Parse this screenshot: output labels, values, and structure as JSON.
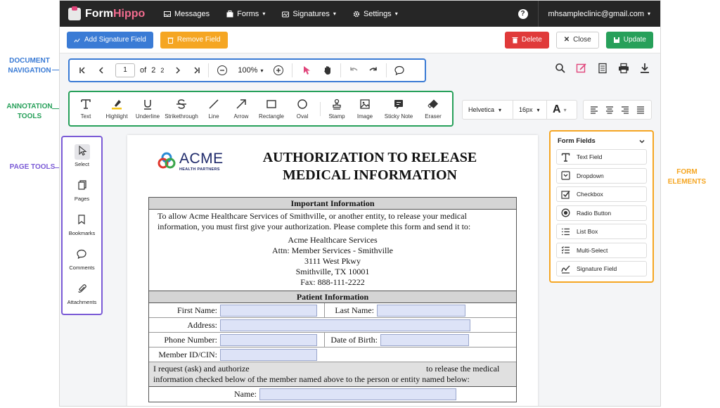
{
  "callouts": {
    "doc_nav": "DOCUMENT\nNAVIGATION",
    "annotation": "ANNOTATION\nTOOLS",
    "page_tools": "PAGE TOOLS",
    "form_elements": "FORM ELEMENTS"
  },
  "colors": {
    "doc_nav": "#3a7bd5",
    "annotation": "#27a05a",
    "page_tools": "#7b5bd6",
    "form_elements": "#f5a623"
  },
  "topnav": {
    "logo_form": "Form",
    "logo_hippo": "Hippo",
    "items": [
      {
        "label": "Messages",
        "icon": "inbox-icon"
      },
      {
        "label": "Forms",
        "icon": "briefcase-icon"
      },
      {
        "label": "Signatures",
        "icon": "signature-icon"
      },
      {
        "label": "Settings",
        "icon": "gear-icon"
      }
    ],
    "help": "?",
    "user_email": "mhsampleclinic@gmail.com"
  },
  "actionbar": {
    "add_signature": "Add Signature Field",
    "remove_field": "Remove Field",
    "delete": "Delete",
    "close": "Close",
    "update": "Update"
  },
  "navigation": {
    "page_current": "1",
    "of": "of",
    "page_total": "2",
    "page_total_extra": "2",
    "zoom": "100%"
  },
  "annotation_tools": [
    "Text",
    "Highlight",
    "Underline",
    "Strikethrough",
    "Line",
    "Arrow",
    "Rectangle",
    "Oval",
    "Stamp",
    "Image",
    "Sticky Note",
    "Eraser"
  ],
  "format": {
    "font": "Helvetica",
    "size": "16px",
    "color_glyph": "A"
  },
  "page_tools": [
    "Select",
    "Pages",
    "Bookmarks",
    "Comments",
    "Attachments"
  ],
  "form_fields": {
    "title": "Form Fields",
    "items": [
      "Text Field",
      "Dropdown",
      "Checkbox",
      "Radio Button",
      "List Box",
      "Multi-Select",
      "Signature Field"
    ]
  },
  "document": {
    "logo_name": "ACME",
    "logo_sub": "HEALTH PARTNERS",
    "title_line1": "AUTHORIZATION TO RELEASE",
    "title_line2": "MEDICAL INFORMATION",
    "important_head": "Important Information",
    "important_line1": "To allow Acme Healthcare Services of Smithville, or another entity, to release your medical",
    "important_line2": "information, you must first give your authorization.  Please complete this form and send it to:",
    "address": [
      "Acme Healthcare Services",
      "Attn: Member Services - Smithville",
      "3111 West Pkwy",
      "Smithville, TX 10001",
      "Fax: 888-111-2222"
    ],
    "patient_head": "Patient Information",
    "first_name": "First Name:",
    "last_name": "Last Name:",
    "address_label": "Address:",
    "phone": "Phone Number:",
    "dob": "Date of Birth:",
    "member_id": "Member ID/CIN:",
    "request_a": "I request (ask) and authorize",
    "request_b": "to release the medical",
    "request_line2": "information checked below of the member named above to the person or entity named below:",
    "name_label": "Name:"
  }
}
